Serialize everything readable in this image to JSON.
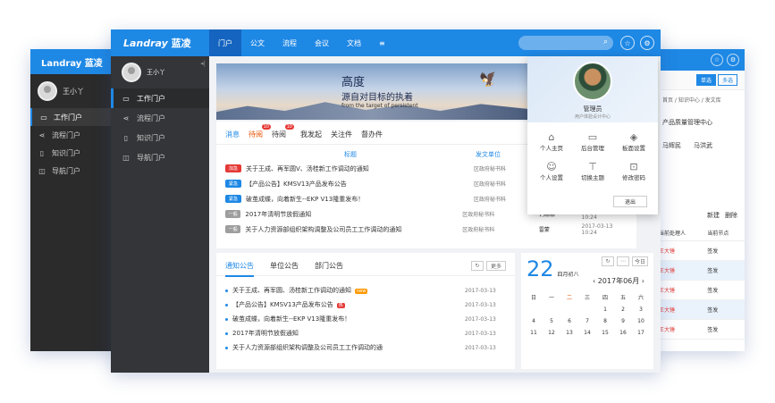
{
  "back_left": {
    "brand": "Landray 蓝凌",
    "user": "王小丫",
    "items": [
      "工作门户",
      "流程门户",
      "知识门户",
      "导航门户"
    ]
  },
  "back_right": {
    "tabs": [
      "单选",
      "多选"
    ],
    "breadcrumb": "首页 / 知识中心 / 发文库",
    "dept": "产品质量管理中心",
    "names": [
      "马辉民",
      "马洪武"
    ],
    "tools": [
      "新建",
      "删除"
    ],
    "headers": [
      "当前处理人",
      "当前节点"
    ],
    "rows": [
      {
        "handler": "王大锤",
        "node": "签发"
      },
      {
        "handler": "王大锤",
        "node": "签发"
      },
      {
        "handler": "王大锤",
        "node": "签发"
      },
      {
        "handler": "王大锤",
        "node": "签发"
      },
      {
        "handler": "王大锤",
        "node": "签发"
      }
    ]
  },
  "main": {
    "brand": "Landray",
    "brand_cn": "蓝凌",
    "nav": [
      "门户",
      "公文",
      "流程",
      "会议",
      "文档"
    ],
    "menu_icon": "≡",
    "user": "王小丫",
    "collapse": "◂|",
    "sidebar": [
      {
        "label": "工作门户",
        "icon": "monitor-icon"
      },
      {
        "label": "流程门户",
        "icon": "share-icon"
      },
      {
        "label": "知识门户",
        "icon": "book-icon"
      },
      {
        "label": "导航门户",
        "icon": "nav-icon"
      }
    ],
    "banner": {
      "title": "高度",
      "subtitle": "源自对目标的执着",
      "english": "from the target of persistent"
    },
    "msg_tabs": [
      {
        "label": "消息",
        "badge": ""
      },
      {
        "label": "待阅",
        "badge": "10"
      },
      {
        "label": "待阅",
        "badge": "10"
      },
      {
        "label": "我发起",
        "badge": ""
      },
      {
        "label": "关注件",
        "badge": ""
      },
      {
        "label": "督办件",
        "badge": ""
      }
    ],
    "msg_cols": [
      "标题",
      "发文单位"
    ],
    "messages": [
      {
        "tag": "加急",
        "color": "#e53935",
        "title": "关于王成、再军圆V、汤桂新工作调动的通知",
        "unit": "区政府秘书科",
        "person": "",
        "date": ""
      },
      {
        "tag": "紧急",
        "color": "#1e88e5",
        "title": "【产品公告】KMSV13产品发布公告",
        "unit": "区政府秘书科",
        "person": "",
        "date": ""
      },
      {
        "tag": "紧急",
        "color": "#1e88e5",
        "title": "破茧成蝶，向着新生--EKP V13隆重发布！",
        "unit": "区政府秘书科",
        "person": "",
        "date": ""
      },
      {
        "tag": "一般",
        "color": "#9e9e9e",
        "title": "2017年清明节放假通知",
        "unit": "区政府秘书科",
        "person": "钙娜娜",
        "date": "2017-03-13  10:24"
      },
      {
        "tag": "一般",
        "color": "#9e9e9e",
        "title": "关于人力资源部组织架构调整及公司员工工作调动的通知",
        "unit": "区政府秘书科",
        "person": "雷蒙",
        "date": "2017-03-13  10:24"
      }
    ],
    "notice_tabs": [
      "通知公告",
      "单位公告",
      "部门公告"
    ],
    "more": "更多",
    "notices": [
      {
        "title": "关于王成、再军圆、汤桂新工作调动的通知",
        "date": "2017-03-13",
        "tag": "new"
      },
      {
        "title": "【产品公告】KMSV13产品发布公告",
        "date": "2017-03-13",
        "tag": "热"
      },
      {
        "title": "破茧成蝶，向着新生--EKP V13隆重发布！",
        "date": "2017-03-13",
        "tag": ""
      },
      {
        "title": "2017年清明节放假通知",
        "date": "2017-03-13",
        "tag": ""
      },
      {
        "title": "关于人力资源部组织架构调整及公司员工工作调动的通",
        "date": "2017-03-13",
        "tag": ""
      }
    ],
    "calendar": {
      "day": "22",
      "lunar": "四月初八",
      "month": "‹ 2017年06月 ›",
      "today": "今日",
      "weekdays": [
        "日",
        "一",
        "二",
        "三",
        "四",
        "五",
        "六"
      ],
      "days": [
        "",
        "",
        "",
        "",
        "1",
        "2",
        "3",
        "4",
        "5",
        "6",
        "7",
        "8",
        "9",
        "10",
        "11",
        "12",
        "13",
        "14",
        "15",
        "16",
        "17"
      ]
    },
    "popup": {
      "name": "管理员",
      "sub": "用户体验设计中心",
      "items": [
        {
          "label": "个人主页",
          "icon": "home-icon"
        },
        {
          "label": "后台管理",
          "icon": "monitor-icon"
        },
        {
          "label": "板面设置",
          "icon": "layers-icon"
        },
        {
          "label": "个人设置",
          "icon": "user-icon"
        },
        {
          "label": "切换主题",
          "icon": "shirt-icon"
        },
        {
          "label": "修改密码",
          "icon": "lock-icon"
        }
      ],
      "exit": "退出"
    }
  }
}
